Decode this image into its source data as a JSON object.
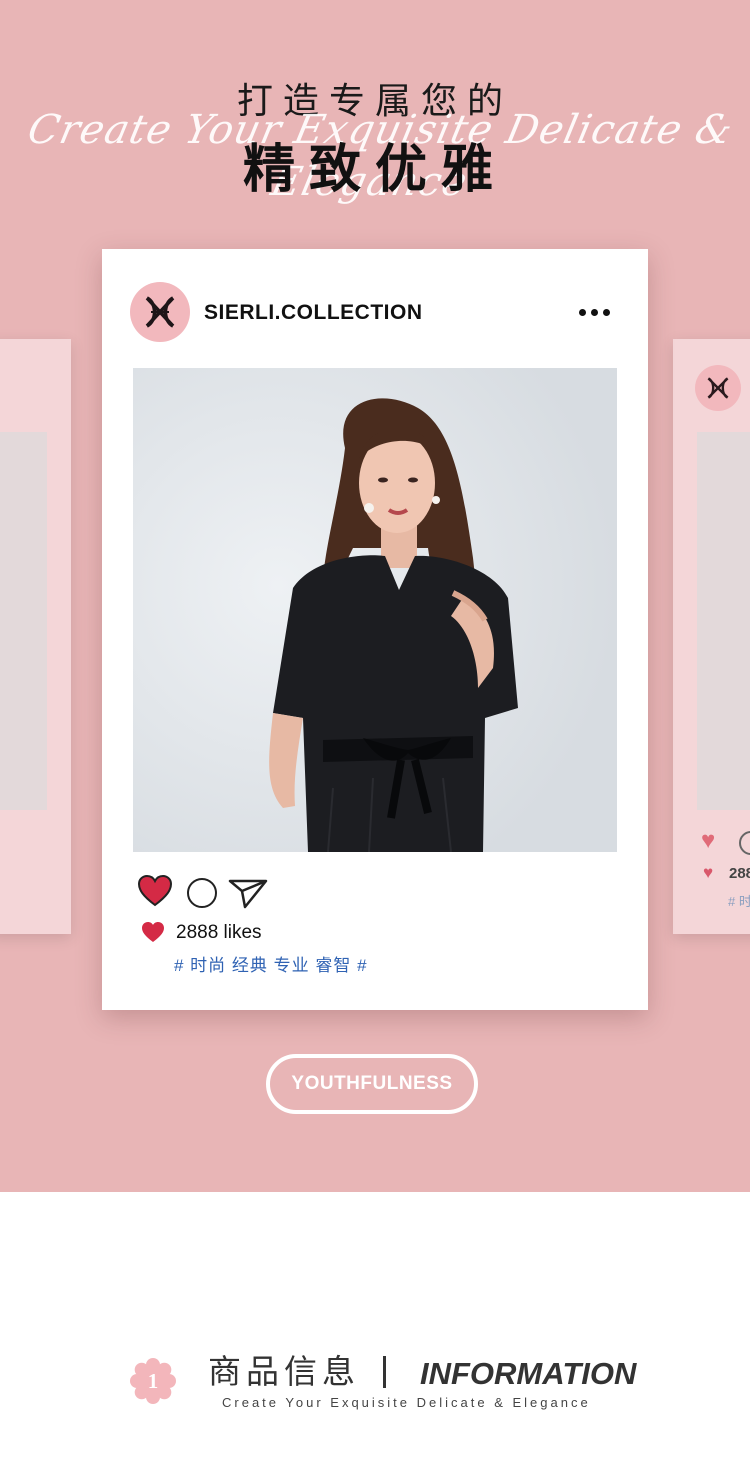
{
  "hero": {
    "title_top": "打造专属您的",
    "script_line": "Create Your Exquisite Delicate & Elegance",
    "title_main": "精致优雅"
  },
  "post": {
    "username": "SIERLI.COLLECTION",
    "likes": "2888 likes",
    "tags": "# 时尚 经典 专业 睿智 #",
    "liked": true
  },
  "ghost_card": {
    "likes": "288",
    "tags": "# 时"
  },
  "tag_pill": "YOUTHFULNESS",
  "section": {
    "number": "1",
    "title_cn": "商品信息",
    "title_en": "INFORMATION",
    "subtitle": "Create Your Exquisite Delicate & Elegance"
  },
  "colors": {
    "hero_bg": "#e8b5b6",
    "avatar_bg": "#f2b8bd",
    "heart": "#d42a45",
    "tag_blue": "#2f62b3"
  }
}
